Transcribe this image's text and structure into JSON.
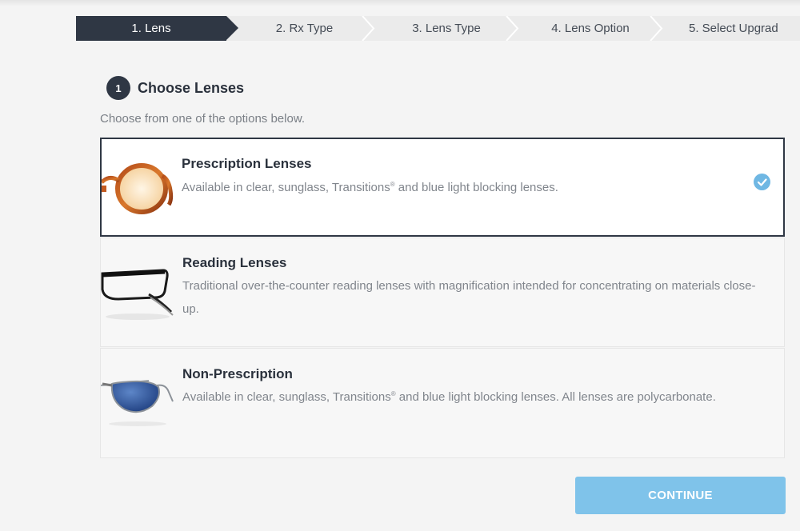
{
  "steps": [
    {
      "label": "1.  Lens",
      "active": true
    },
    {
      "label": "2.  Rx Type",
      "active": false
    },
    {
      "label": "3.  Lens Type",
      "active": false
    },
    {
      "label": "4.  Lens Option",
      "active": false
    },
    {
      "label": "5.  Select Upgrad",
      "active": false
    }
  ],
  "section": {
    "number": "1",
    "title": "Choose Lenses",
    "subtitle": "Choose from one of the options below."
  },
  "options": [
    {
      "title": "Prescription Lenses",
      "desc_before": "Available in clear, sunglass, Transitions",
      "desc_sup": "®",
      "desc_after": " and blue light blocking lenses.",
      "selected": true,
      "icon": "tortoise-round-glasses"
    },
    {
      "title": "Reading Lenses",
      "desc_before": "Traditional over-the-counter reading lenses with magnification intended for concentrating on materials close-up.",
      "desc_sup": "",
      "desc_after": "",
      "selected": false,
      "icon": "black-rectangle-glasses"
    },
    {
      "title": "Non-Prescription",
      "desc_before": "Available in clear, sunglass, Transitions",
      "desc_sup": "®",
      "desc_after": " and blue light blocking lenses. All lenses are polycarbonate.",
      "selected": false,
      "icon": "aviator-sunglasses"
    }
  ],
  "continue_label": "CONTINUE",
  "colors": {
    "dark": "#2f3744",
    "accent": "#7fc3ea",
    "check": "#6fb7e3"
  }
}
